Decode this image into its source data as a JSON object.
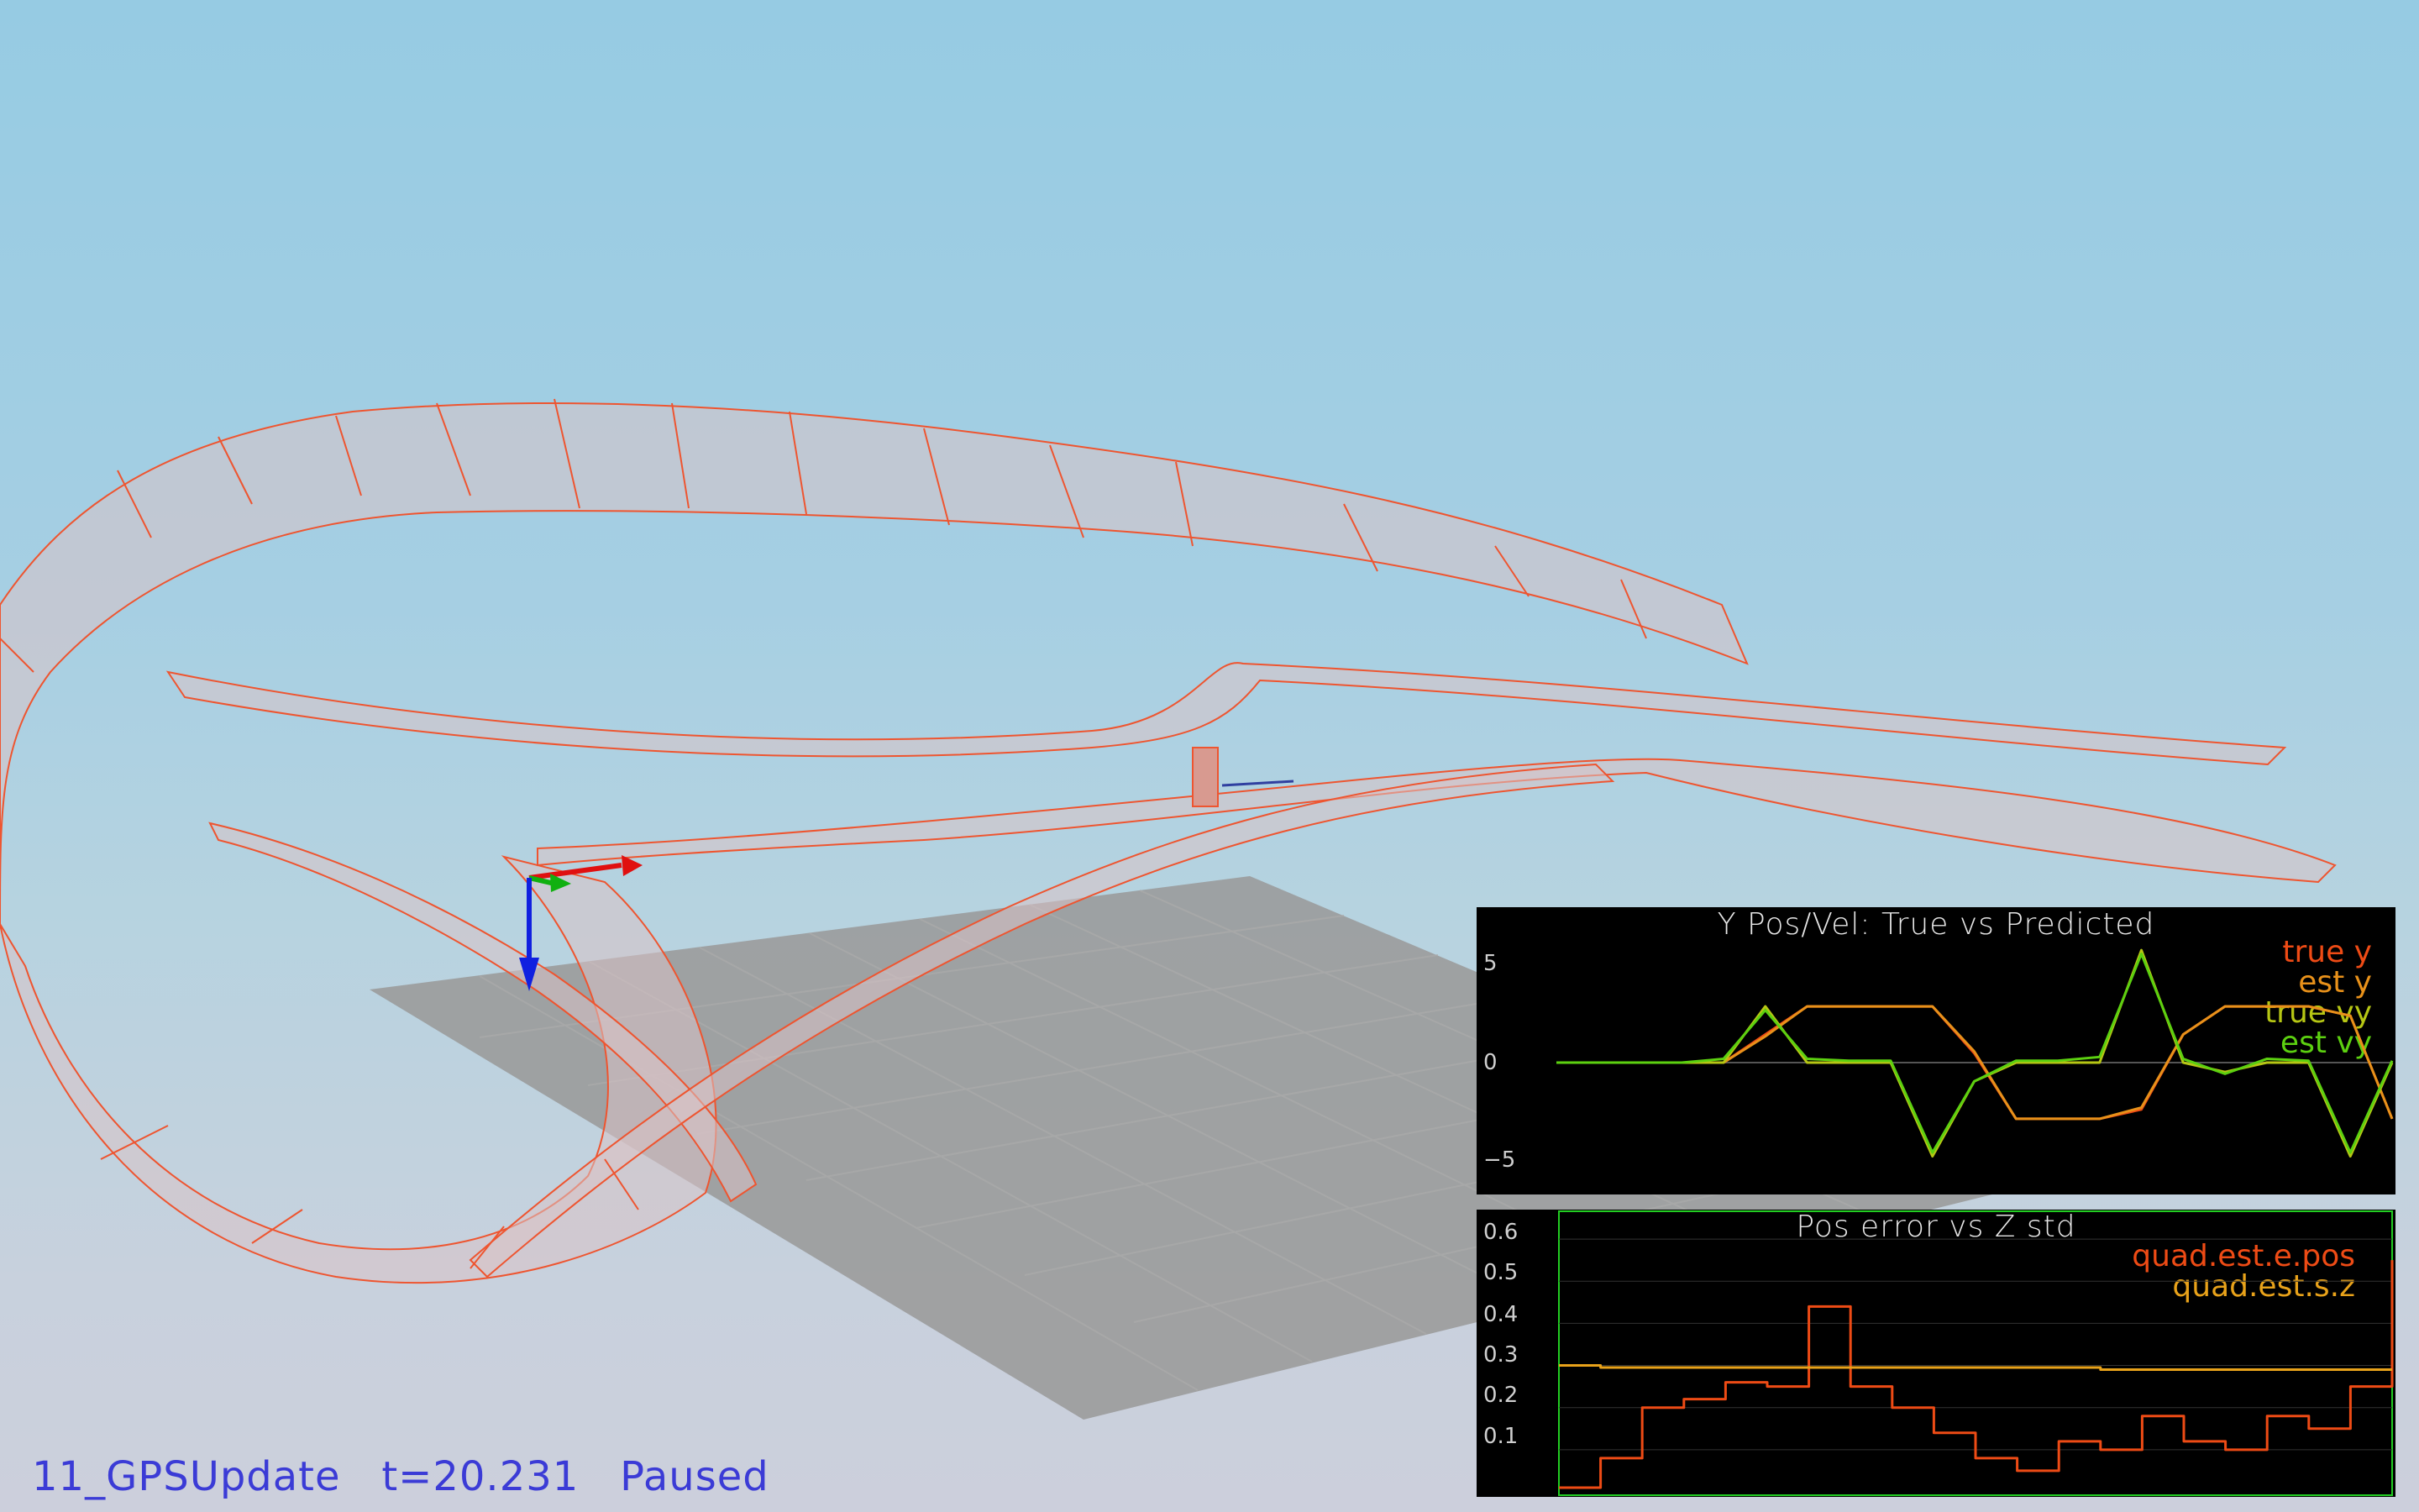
{
  "status": {
    "scenario": "11_GPSUpdate",
    "time": "t=20.231",
    "state": "Paused"
  },
  "colors": {
    "trajectory": "#ee5530",
    "ribbon_fill": "#d8c2c6",
    "ground": "#9a9a9a",
    "axis_x": "#e01010",
    "axis_y": "#10b010",
    "axis_z": "#1020e0",
    "status_text": "#3b3bd6"
  },
  "panels": [
    {
      "id": "y-pos-vel",
      "title": "Y Pos/Vel: True vs Predicted",
      "legend": [
        {
          "label": "true y",
          "color": "#ee4b15"
        },
        {
          "label": "est y",
          "color": "#e8911a"
        },
        {
          "label": "true vy",
          "color": "#b6c614"
        },
        {
          "label": "est vy",
          "color": "#5cd010"
        }
      ],
      "y_ticks": [
        "5",
        "0",
        "−5"
      ]
    },
    {
      "id": "pos-error-z-std",
      "title": "Pos error vs Z std",
      "legend": [
        {
          "label": "quad.est.e.pos",
          "color": "#ee4b15"
        },
        {
          "label": "quad.est.s.z",
          "color": "#e8a21a"
        }
      ],
      "y_ticks": [
        "0.6",
        "0.5",
        "0.4",
        "0.3",
        "0.2",
        "0.1"
      ]
    }
  ],
  "chart_data": [
    {
      "type": "line",
      "title": "Y Pos/Vel: True vs Predicted",
      "xlabel": "",
      "ylabel": "",
      "x": [
        0,
        1,
        2,
        3,
        4,
        5,
        6,
        7,
        8,
        9,
        10,
        11,
        12,
        13,
        14,
        15,
        16,
        17,
        18,
        19,
        20
      ],
      "ylim": [
        -6.5,
        6.5
      ],
      "yticks": [
        5,
        0,
        -5
      ],
      "series": [
        {
          "name": "true y",
          "values": [
            0,
            0,
            0,
            0,
            0,
            1.5,
            3,
            3,
            3,
            3,
            0.5,
            -3,
            -3,
            -3,
            -2.5,
            1.5,
            3,
            3,
            3,
            2.5,
            -3
          ]
        },
        {
          "name": "est y",
          "values": [
            0,
            0,
            0,
            0,
            0,
            1.4,
            3,
            3,
            3,
            3,
            0.6,
            -3,
            -3,
            -3,
            -2.4,
            1.5,
            3,
            3,
            3,
            2.5,
            -3
          ]
        },
        {
          "name": "true vy",
          "values": [
            0,
            0,
            0,
            0,
            0,
            3,
            0,
            0,
            0,
            -5,
            -1,
            0,
            0,
            0,
            6,
            0,
            -0.5,
            0,
            0,
            -5,
            0
          ]
        },
        {
          "name": "est vy",
          "values": [
            0,
            0,
            0,
            0,
            0.2,
            2.8,
            0.2,
            0.1,
            0.1,
            -4.8,
            -1,
            0.1,
            0.1,
            0.3,
            5.8,
            0.2,
            -0.6,
            0.2,
            0.1,
            -4.8,
            0.1
          ]
        }
      ],
      "grid": false,
      "legend_position": "top-right"
    },
    {
      "type": "line",
      "title": "Pos error vs Z std",
      "xlabel": "",
      "ylabel": "",
      "x": [
        0,
        1,
        2,
        3,
        4,
        5,
        6,
        7,
        8,
        9,
        10,
        11,
        12,
        13,
        14,
        15,
        16,
        17,
        18,
        19,
        20
      ],
      "ylim": [
        0,
        0.65
      ],
      "yticks": [
        0.1,
        0.2,
        0.3,
        0.4,
        0.5,
        0.6
      ],
      "series": [
        {
          "name": "quad.est.e.pos",
          "values": [
            0.01,
            0.08,
            0.2,
            0.22,
            0.26,
            0.25,
            0.44,
            0.25,
            0.2,
            0.14,
            0.08,
            0.05,
            0.12,
            0.1,
            0.18,
            0.12,
            0.1,
            0.18,
            0.15,
            0.25,
            0.55
          ]
        },
        {
          "name": "quad.est.s.z",
          "values": [
            0.3,
            0.295,
            0.295,
            0.295,
            0.295,
            0.295,
            0.295,
            0.295,
            0.295,
            0.295,
            0.295,
            0.295,
            0.295,
            0.29,
            0.29,
            0.29,
            0.29,
            0.29,
            0.29,
            0.29,
            0.29
          ]
        }
      ],
      "grid": true,
      "legend_position": "top-right"
    }
  ]
}
